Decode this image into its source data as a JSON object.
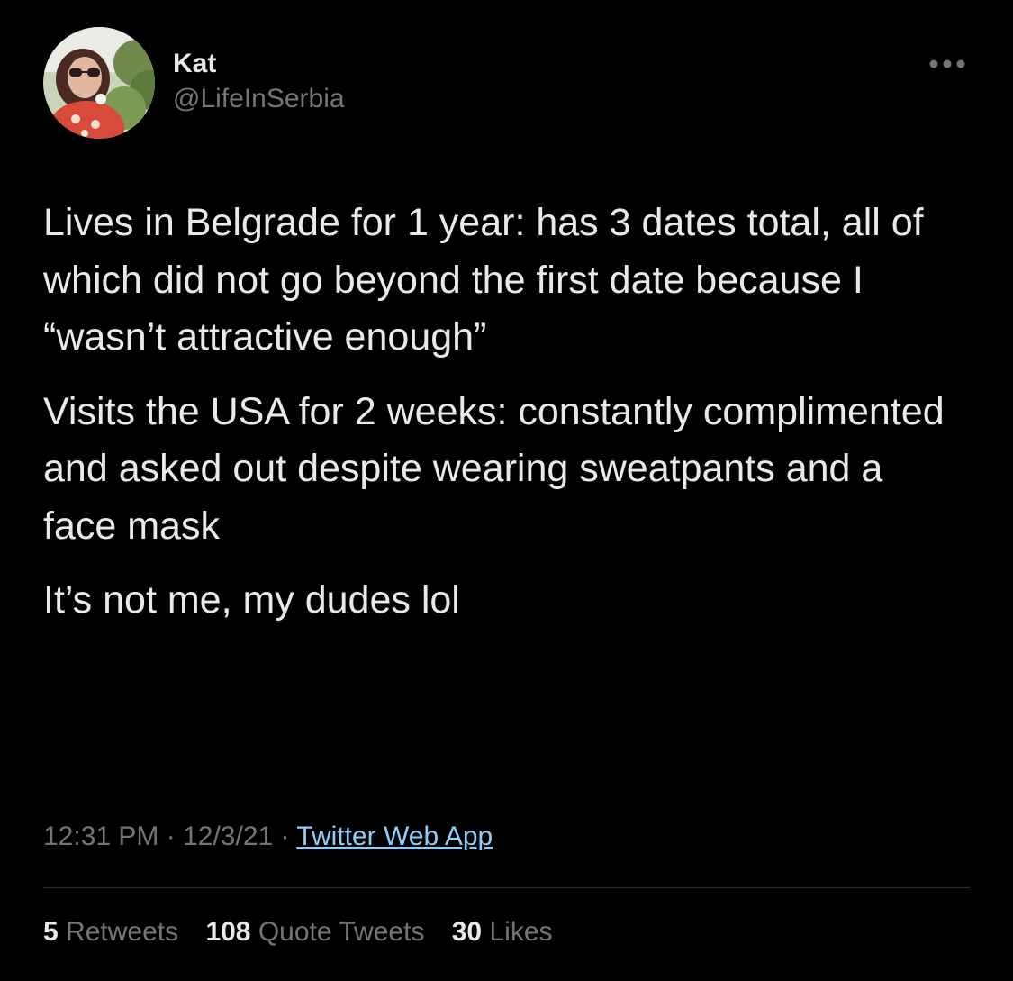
{
  "tweet": {
    "author": {
      "display_name": "Kat",
      "handle": "@LifeInSerbia"
    },
    "more_icon": "more-options-icon",
    "paragraphs": [
      "Lives in Belgrade for 1 year: has 3 dates total, all of which did not go beyond the first date because I “wasn’t attractive enough”",
      "Visits the USA for 2 weeks: constantly complimented and asked out despite wearing sweatpants and a face mask",
      "It’s not me, my dudes lol"
    ],
    "time": "12:31 PM",
    "separator": " · ",
    "date": "12/3/21",
    "source": "Twitter Web App",
    "stats": {
      "retweets_count": "5",
      "retweets_label": "Retweets",
      "quotes_count": "108",
      "quotes_label": "Quote Tweets",
      "likes_count": "30",
      "likes_label": "Likes"
    }
  },
  "colors": {
    "background": "#000000",
    "primary_text": "#e7e9ea",
    "secondary_text": "#71767b",
    "link": "#8ecdf8",
    "divider": "#2f3336"
  }
}
